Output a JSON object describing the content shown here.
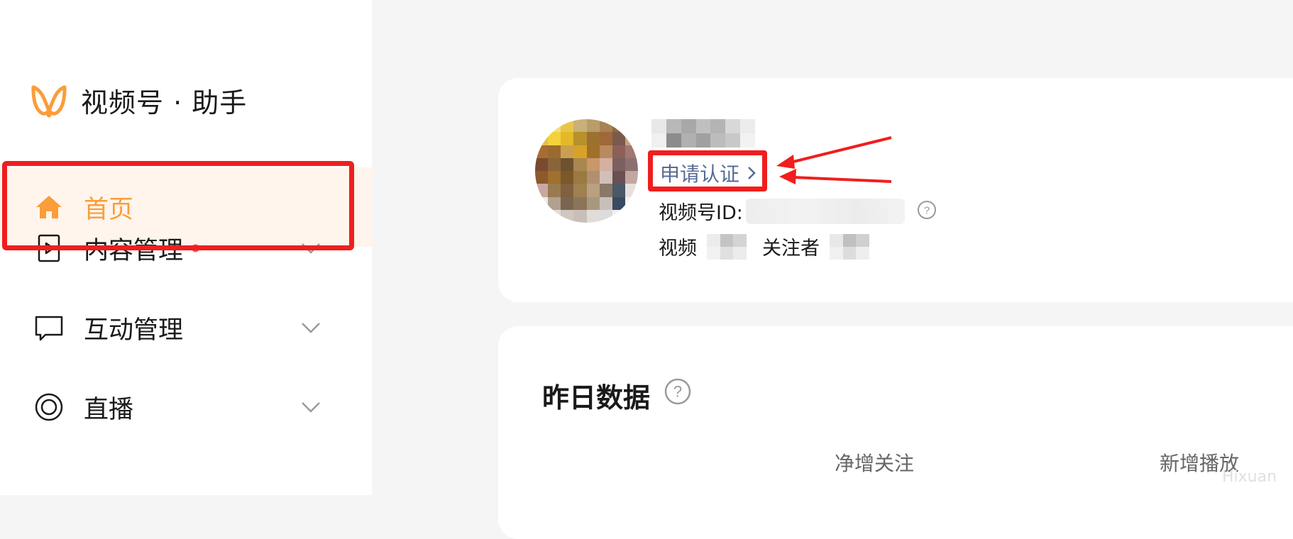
{
  "brand": {
    "name": "视频号 · 助手",
    "logo_icon": "channels-logo-icon",
    "logo_color": "#fa9d3b"
  },
  "sidebar": {
    "items": [
      {
        "label": "首页",
        "icon": "home-icon",
        "active": true
      },
      {
        "label": "内容管理",
        "icon": "video-file-icon",
        "has_badge": true,
        "expandable": true
      },
      {
        "label": "互动管理",
        "icon": "chat-bubble-icon",
        "expandable": true
      },
      {
        "label": "直播",
        "icon": "live-icon",
        "expandable": true
      }
    ]
  },
  "profile": {
    "verify_link": "申请认证",
    "id_label": "视频号ID:",
    "stats": {
      "videos_label": "视频",
      "followers_label": "关注者"
    }
  },
  "yesterday": {
    "title": "昨日数据",
    "metrics": [
      "净增关注",
      "新增播放"
    ]
  },
  "watermark": "Hixuan",
  "colors": {
    "accent": "#fa9d3b",
    "link": "#576b95",
    "annotation_red": "#f01e1e",
    "badge_red": "#fa5151"
  }
}
